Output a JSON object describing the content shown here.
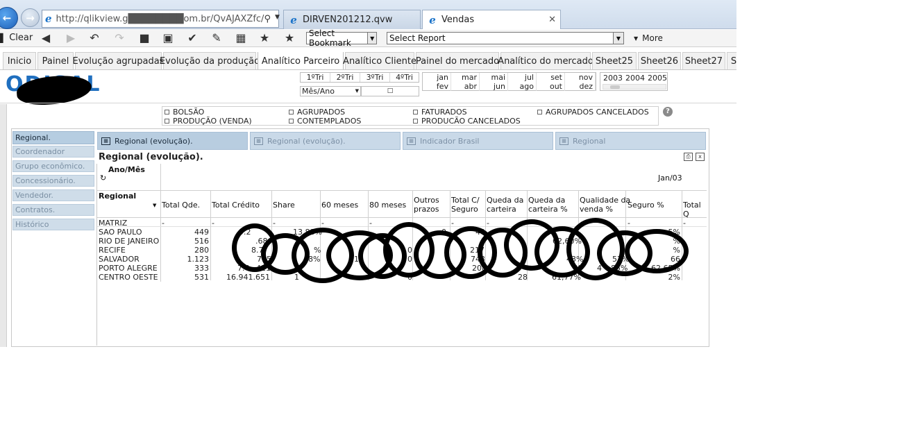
{
  "browser": {
    "url": "http://qlikview.g████████om.br/QvAJAXZfc/",
    "tabs": [
      {
        "title": "DIRVEN201212.qvw"
      },
      {
        "title": "Vendas"
      }
    ]
  },
  "toolbar": {
    "clear_label": "Clear",
    "bookmark_select": "Select Bookmark",
    "report_select": "Select Report",
    "more_label": "More"
  },
  "sheet_tabs": [
    "Inicio",
    "Painel",
    "Evolução agrupadas",
    "Evolução da produção",
    "Analítico Parceiro",
    "Analítico Cliente",
    "Painel do mercado",
    "Analítico do mercado",
    "Sheet25",
    "Sheet26",
    "Sheet27",
    "S"
  ],
  "active_sheet_tab": "Analítico Parceiro",
  "logo": {
    "text": "ODISAL"
  },
  "filters": {
    "quarters": [
      "1ºTri",
      "2ºTri",
      "3ºTri",
      "4ºTri"
    ],
    "mesano_label": "Mês/Ano",
    "months_top": [
      "jan",
      "mar",
      "mai",
      "jul",
      "set",
      "nov"
    ],
    "months_bottom": [
      "fev",
      "abr",
      "jun",
      "ago",
      "out",
      "dez"
    ],
    "years": [
      "2003",
      "2004",
      "2005"
    ]
  },
  "checkboxes": [
    "BOLSÃO",
    "AGRUPADOS",
    "FATURADOS",
    "AGRUPADOS CANCELADOS",
    "PRODUÇÃO (VENDA)",
    "CONTEMPLADOS",
    "PRODUCÃO CANCELADOS"
  ],
  "sidebar": [
    "Regional.",
    "Coordenador",
    "Grupo econômico.",
    "Concessionário.",
    "Vendedor.",
    "Contratos.",
    "Histórico"
  ],
  "chart_tabs": [
    "Regional (evolução).",
    "Regional (evolução).",
    "Indicador Brasil",
    "Regional"
  ],
  "chart": {
    "title": "Regional (evolução).",
    "dim_header": "Ano/Mês",
    "row_header": "Regional",
    "period": "Jan/03",
    "columns": [
      "Total Qde.",
      "Total Crédito",
      "Share",
      "60 meses",
      "80 meses",
      "Outros\nprazos",
      "Total C/\nSeguro",
      "Queda da\ncarteira",
      "Queda da\ncarteira %",
      "Qualidade da\nvenda %",
      "Seguro %",
      "Total Q"
    ],
    "rows": [
      {
        "name": "MATRIZ",
        "qde": "-",
        "credito": "-",
        "share": "-",
        "queda_pct": "-",
        "qual_pct": "-",
        "seguro_pct": "-"
      },
      {
        "name": "SAO PAULO",
        "qde": "449",
        "credito": "9.2",
        "share": "13,88%",
        "queda_pct": "",
        "qual_pct": "",
        "seguro_pct": "5%"
      },
      {
        "name": "RIO DE JANEIRO",
        "qde": "516",
        "credito": ".68",
        "share": "",
        "queda_pct": "62,60%",
        "qual_pct": "",
        "seguro_pct": "%"
      },
      {
        "name": "RECIFE",
        "qde": "280",
        "credito": "8.7",
        "share": "%",
        "queda_pct": "5",
        "qual_pct": "",
        "seguro_pct": "%"
      },
      {
        "name": "SALVADOR",
        "qde": "1.123",
        "credito": "715",
        "share": "8%",
        "queda_pct": "43%",
        "qual_pct": "57%",
        "seguro_pct": "66"
      },
      {
        "name": "PORTO ALEGRE",
        "qde": "333",
        "credito": "7.4",
        "share": "",
        "queda_pct": "%",
        "qual_pct": "4",
        "seguro_pct": "62,65%"
      },
      {
        "name": "CENTRO OESTE",
        "qde": "531",
        "credito": "16.941.651",
        "share": "1",
        "queda_pct": "61,77%",
        "qual_pct": "",
        "seguro_pct": "2%"
      }
    ],
    "fragments": {
      "r1_outros": "0",
      "r3_outros": "0",
      "r4_outros": "0",
      "r6_outros": "0",
      "r2_seguro": "40",
      "r3_seguro": "217",
      "r4_seguro": "743",
      "r5_seguro": "208",
      "r1_credito2": "411",
      "r4_60m": "16",
      "r6_queda": "28",
      "r5_qual": "85%"
    }
  },
  "colors": {
    "tab_active": "#b8cde0",
    "tab_inactive": "#c9d9e8",
    "brand": "#1f6fbf"
  }
}
